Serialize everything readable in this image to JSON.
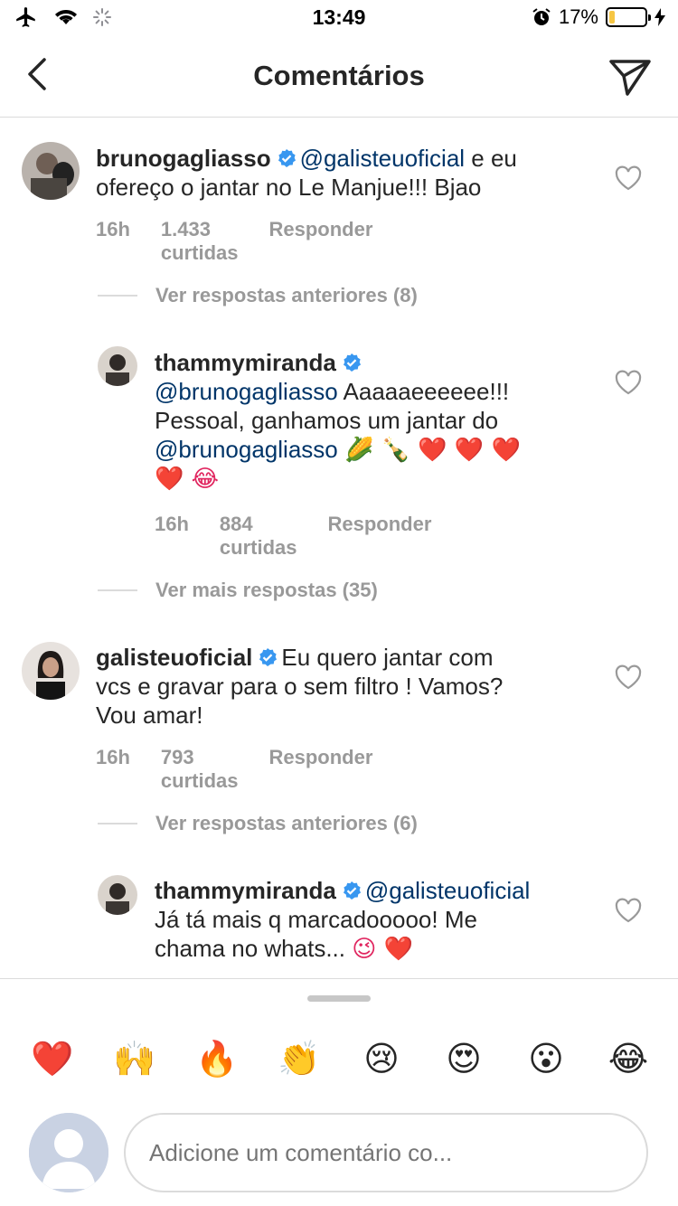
{
  "status_bar": {
    "time": "13:49",
    "battery_percent": "17%",
    "battery_level": 0.17,
    "icons": [
      "airplane-icon",
      "wifi-icon",
      "activity-spinner-icon",
      "alarm-icon",
      "battery-icon",
      "charging-bolt-icon"
    ]
  },
  "nav": {
    "title": "Comentários",
    "back_icon": "chevron-left-icon",
    "send_icon": "paper-plane-icon"
  },
  "colors": {
    "mention": "#003569",
    "verified": "#3897f0",
    "meta_text": "#999999",
    "heart_red": "#e0245e"
  },
  "comments": [
    {
      "username": "brunogagliasso",
      "verified": true,
      "mention": "@galisteuoficial",
      "text_line1_rest": " e eu",
      "text_line2": "ofereço o jantar no Le Manjue!!! Bjao",
      "time": "16h",
      "likes": "1.433 curtidas",
      "reply": "Responder"
    },
    {
      "view_replies": "Ver respostas anteriores (8)"
    },
    {
      "username": "thammymiranda",
      "verified": true,
      "line1_mention": "@brunogagliasso",
      "line1_rest": " Aaaaaeeeeee!!!",
      "line2": "Pessoal, ganhamos um jantar do",
      "line3_mention": "@brunogagliasso",
      "line3_emojis": "🌽 🍾 ❤️ ❤️ ❤️",
      "line4_emojis": "❤️ 😂",
      "time": "16h",
      "likes": "884 curtidas",
      "reply": "Responder"
    },
    {
      "view_replies": "Ver mais respostas (35)"
    },
    {
      "username": "galisteuoficial",
      "verified": true,
      "line1_rest": "Eu quero jantar com",
      "line2": "vcs e gravar para o sem filtro ! Vamos?",
      "line3": "Vou amar!",
      "time": "16h",
      "likes": "793 curtidas",
      "reply": "Responder"
    },
    {
      "view_replies": "Ver respostas anteriores (6)"
    },
    {
      "username": "thammymiranda",
      "verified": true,
      "line1_mention": "@galisteuoficial",
      "line2": "Já tá mais q marcadooooo! Me",
      "line3": "chama no whats...",
      "line3_emojis": "😉 ❤️"
    }
  ],
  "quick_reactions": [
    "❤️",
    "🙌",
    "🔥",
    "👏",
    "😢",
    "😍",
    "😮",
    "😂"
  ],
  "composer": {
    "placeholder": "Adicione um comentário co..."
  }
}
